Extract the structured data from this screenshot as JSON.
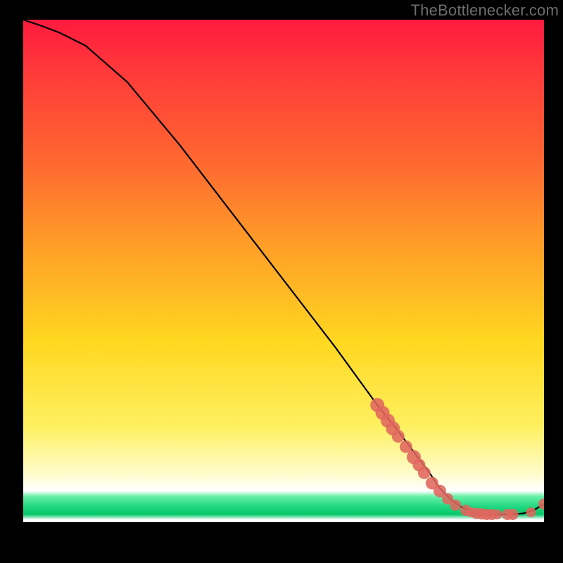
{
  "watermark": "TheBottlenecker.com",
  "chart_data": {
    "type": "line",
    "title": "",
    "xlabel": "",
    "ylabel": "",
    "xlim": [
      0,
      100
    ],
    "ylim": [
      0,
      100
    ],
    "grid": false,
    "series": [
      {
        "name": "curve",
        "color": "#000000",
        "x": [
          0,
          3,
          7,
          12,
          20,
          30,
          40,
          50,
          60,
          68,
          72,
          75,
          78,
          80,
          82,
          84,
          86,
          88,
          90,
          92,
          94,
          96,
          98,
          100
        ],
        "y": [
          100,
          99,
          97.5,
          95,
          88,
          76,
          63,
          50,
          37,
          26,
          21,
          17,
          13,
          10,
          8,
          6.5,
          5.5,
          5,
          5,
          5,
          5,
          5.2,
          5.8,
          7
        ]
      }
    ],
    "markers": {
      "name": "highlighted-points",
      "color": "#e0675e",
      "size_default": 9,
      "points": [
        {
          "x": 68,
          "y": 26,
          "r": 10
        },
        {
          "x": 69,
          "y": 24.5,
          "r": 10
        },
        {
          "x": 70,
          "y": 23,
          "r": 10
        },
        {
          "x": 71,
          "y": 21.5,
          "r": 10
        },
        {
          "x": 72,
          "y": 20,
          "r": 9
        },
        {
          "x": 73.5,
          "y": 18,
          "r": 9
        },
        {
          "x": 75,
          "y": 16,
          "r": 10
        },
        {
          "x": 76,
          "y": 14.5,
          "r": 9
        },
        {
          "x": 77,
          "y": 13,
          "r": 9
        },
        {
          "x": 78.5,
          "y": 11,
          "r": 9
        },
        {
          "x": 80,
          "y": 9.5,
          "r": 9
        },
        {
          "x": 81.5,
          "y": 8,
          "r": 8
        },
        {
          "x": 83,
          "y": 6.8,
          "r": 8
        },
        {
          "x": 85,
          "y": 5.8,
          "r": 8
        },
        {
          "x": 86,
          "y": 5.4,
          "r": 7
        },
        {
          "x": 87,
          "y": 5.2,
          "r": 8
        },
        {
          "x": 88,
          "y": 5.1,
          "r": 8
        },
        {
          "x": 89,
          "y": 5.0,
          "r": 8
        },
        {
          "x": 90,
          "y": 5.0,
          "r": 8
        },
        {
          "x": 91,
          "y": 5.0,
          "r": 7
        },
        {
          "x": 93,
          "y": 5.0,
          "r": 8
        },
        {
          "x": 94,
          "y": 5.0,
          "r": 8
        },
        {
          "x": 97.5,
          "y": 5.4,
          "r": 7
        },
        {
          "x": 100,
          "y": 7.0,
          "r": 8
        }
      ]
    },
    "background": {
      "type": "vertical-gradient",
      "stops": [
        {
          "pos": 0.0,
          "color": "#ff1a3f"
        },
        {
          "pos": 0.28,
          "color": "#ff6a30"
        },
        {
          "pos": 0.62,
          "color": "#ffd820"
        },
        {
          "pos": 0.88,
          "color": "#fffcc8"
        },
        {
          "pos": 0.905,
          "color": "#ffffff"
        },
        {
          "pos": 0.93,
          "color": "#20d880"
        },
        {
          "pos": 0.96,
          "color": "#ffffff"
        },
        {
          "pos": 0.965,
          "color": "#000000"
        }
      ]
    }
  }
}
